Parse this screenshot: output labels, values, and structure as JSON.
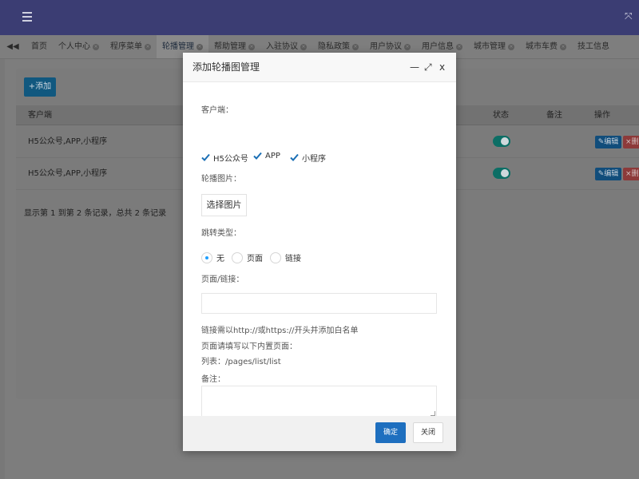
{
  "topbar": {
    "menu_icon": "hamburger-icon",
    "expand_icon": "expand-icon"
  },
  "tabbar": {
    "nav_left_icon": "double-chevron-left-icon",
    "tabs": [
      {
        "label": "首页",
        "active": false,
        "closable": false
      },
      {
        "label": "个人中心",
        "active": false,
        "closable": true
      },
      {
        "label": "程序菜单",
        "active": false,
        "closable": true
      },
      {
        "label": "轮播管理",
        "active": true,
        "closable": true
      },
      {
        "label": "帮助管理",
        "active": false,
        "closable": true
      },
      {
        "label": "入驻协议",
        "active": false,
        "closable": true
      },
      {
        "label": "隐私政策",
        "active": false,
        "closable": true
      },
      {
        "label": "用户协议",
        "active": false,
        "closable": true
      },
      {
        "label": "用户信息",
        "active": false,
        "closable": true
      },
      {
        "label": "城市管理",
        "active": false,
        "closable": true
      },
      {
        "label": "城市车费",
        "active": false,
        "closable": true
      },
      {
        "label": "技工信息",
        "active": false,
        "closable": false
      }
    ]
  },
  "panel": {
    "add_button_label": "+添加",
    "table": {
      "headers": {
        "client": "客户端",
        "status": "状态",
        "remark": "备注",
        "actions": "操作"
      },
      "rows": [
        {
          "client": "H5公众号,APP,小程序",
          "status_on": true,
          "edit_label": "编辑",
          "delete_label": "删"
        },
        {
          "client": "H5公众号,APP,小程序",
          "status_on": true,
          "edit_label": "编辑",
          "delete_label": "删"
        }
      ]
    },
    "summary": "显示第 1 到第 2 条记录，总共 2 条记录"
  },
  "modal": {
    "title": "添加轮播图管理",
    "minimize_glyph": "—",
    "maximize_glyph": "⤢",
    "close_glyph": "x",
    "client_label": "客户端：",
    "client_options": [
      {
        "label": "H5公众号",
        "checked": true
      },
      {
        "label": "APP",
        "checked": true
      },
      {
        "label": "小程序",
        "checked": true
      }
    ],
    "image_label": "轮播图片：",
    "select_image_button": "选择图片",
    "jump_type_label": "跳转类型：",
    "jump_options": [
      {
        "label": "无",
        "selected": true
      },
      {
        "label": "页面",
        "selected": false
      },
      {
        "label": "链接",
        "selected": false
      }
    ],
    "page_link_label": "页面/链接：",
    "page_link_value": "",
    "hint_1": "链接需以http://或https://开头并添加白名单",
    "hint_2": "页面请填写以下内置页面：",
    "hint_3": "列表：/pages/list/list",
    "remark_label": "备注：",
    "remark_value": "",
    "ok_button": "确定",
    "close_button": "关闭",
    "accent_color": "#1e9fff",
    "ok_color": "#1e6fbf"
  }
}
